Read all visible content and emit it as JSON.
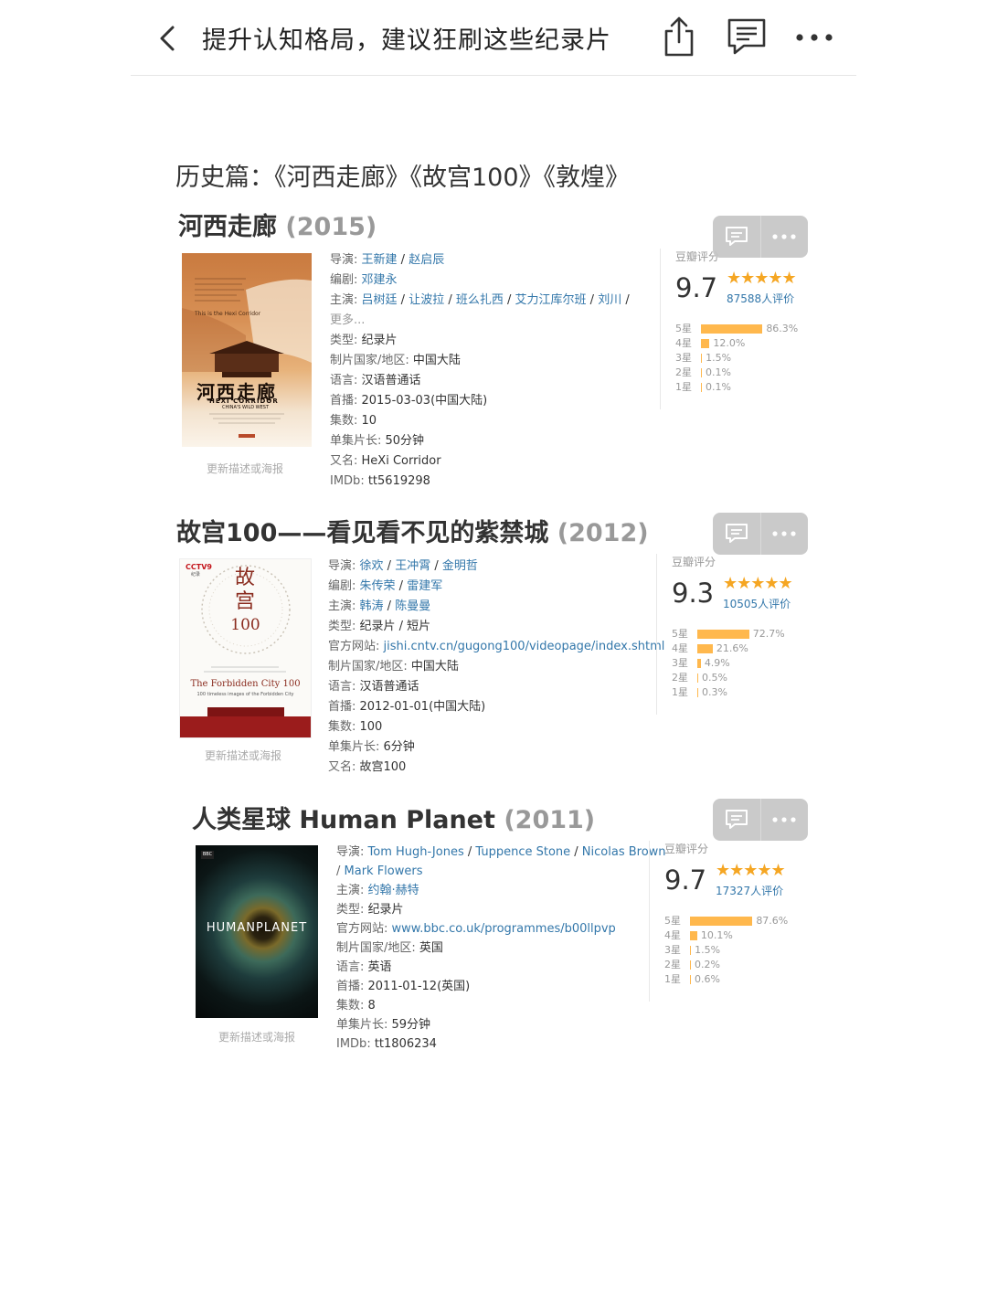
{
  "nav": {
    "title": "提升认知格局，建议狂刷这些纪录片",
    "back_icon": "chevron-left-icon",
    "share_icon": "share-icon",
    "comment_icon": "comment-icon",
    "more_icon": "more-icon"
  },
  "section_heading": "历史篇：《河西走廊》《故宫100》《敦煌》",
  "common": {
    "rating_label": "豆瓣评分",
    "update_link": "更新描述或海报"
  },
  "films": [
    {
      "title": "河西走廊",
      "year": "(2015)",
      "poster": {
        "title_cn": "河西走廊",
        "sub": "HEXI CORRIDOR",
        "sub2": "CHINA'S WILD WEST",
        "text": "This is the Hexi Corridor"
      },
      "info": [
        {
          "label": "导演: ",
          "links": [
            "王新建",
            "赵启辰"
          ]
        },
        {
          "label": "编剧: ",
          "links": [
            "邓建永"
          ]
        },
        {
          "label": "主演: ",
          "links": [
            "吕树廷",
            "让波拉",
            "班么扎西",
            "艾力江库尔班",
            "刘川"
          ],
          "trail": " /"
        },
        {
          "label": "更多...",
          "muted": true
        },
        {
          "label": "类型: ",
          "value": "纪录片"
        },
        {
          "label": "制片国家/地区: ",
          "value": "中国大陆"
        },
        {
          "label": "语言: ",
          "value": "汉语普通话"
        },
        {
          "label": "首播: ",
          "value": "2015-03-03(中国大陆)"
        },
        {
          "label": "集数: ",
          "value": "10"
        },
        {
          "label": "单集片长: ",
          "value": "50分钟"
        },
        {
          "label": "又名: ",
          "value": "HeXi Corridor"
        },
        {
          "label": "IMDb: ",
          "value": "tt5619298"
        }
      ],
      "rating": {
        "score": "9.7",
        "stars": "★★★★★",
        "votes": "87588人评价",
        "dist": [
          {
            "label": "5星",
            "pct": "86.3%",
            "v": 86.3
          },
          {
            "label": "4星",
            "pct": "12.0%",
            "v": 12.0
          },
          {
            "label": "3星",
            "pct": "1.5%",
            "v": 1.5
          },
          {
            "label": "2星",
            "pct": "0.1%",
            "v": 0.1
          },
          {
            "label": "1星",
            "pct": "0.1%",
            "v": 0.1
          }
        ]
      }
    },
    {
      "title": "故宫100——看见看不见的紫禁城",
      "year": "(2012)",
      "poster": {
        "title_cn": "故宫",
        "num": "100",
        "en": "The Forbidden City 100",
        "en2": "100 timeless images of the Forbidden City",
        "brand": "CCTV9",
        "brand_sub": "纪录"
      },
      "info": [
        {
          "label": "导演: ",
          "links": [
            "徐欢",
            "王冲霄",
            "金明哲"
          ]
        },
        {
          "label": "编剧: ",
          "links": [
            "朱传荣",
            "雷建军"
          ]
        },
        {
          "label": "主演: ",
          "links": [
            "韩涛",
            "陈曼曼"
          ]
        },
        {
          "label": "类型: ",
          "value": "纪录片 / 短片"
        },
        {
          "label": "官方网站: ",
          "links": [
            "jishi.cntv.cn/gugong100/videopage/index.shtml"
          ]
        },
        {
          "label": "制片国家/地区: ",
          "value": "中国大陆"
        },
        {
          "label": "语言: ",
          "value": "汉语普通话"
        },
        {
          "label": "首播: ",
          "value": "2012-01-01(中国大陆)"
        },
        {
          "label": "集数: ",
          "value": "100"
        },
        {
          "label": "单集片长: ",
          "value": "6分钟"
        },
        {
          "label": "又名: ",
          "value": "故宫100"
        }
      ],
      "rating": {
        "score": "9.3",
        "stars": "★★★★★",
        "votes": "10505人评价",
        "dist": [
          {
            "label": "5星",
            "pct": "72.7%",
            "v": 72.7
          },
          {
            "label": "4星",
            "pct": "21.6%",
            "v": 21.6
          },
          {
            "label": "3星",
            "pct": "4.9%",
            "v": 4.9
          },
          {
            "label": "2星",
            "pct": "0.5%",
            "v": 0.5
          },
          {
            "label": "1星",
            "pct": "0.3%",
            "v": 0.3
          }
        ]
      }
    },
    {
      "title": "人类星球 Human Planet",
      "year": "(2011)",
      "poster": {
        "title_cn": "HUMANPLANET",
        "brand": "BBC"
      },
      "info": [
        {
          "label": "导演: ",
          "links": [
            "Tom Hugh-Jones",
            "Tuppence Stone",
            "Nicolas Brown"
          ]
        },
        {
          "label": "/ ",
          "links": [
            "Mark Flowers"
          ],
          "cont": true
        },
        {
          "label": "主演: ",
          "links": [
            "约翰·赫特"
          ]
        },
        {
          "label": "类型: ",
          "value": "纪录片"
        },
        {
          "label": "官方网站: ",
          "links": [
            "www.bbc.co.uk/programmes/b00llpvp"
          ]
        },
        {
          "label": "制片国家/地区: ",
          "value": "英国"
        },
        {
          "label": "语言: ",
          "value": "英语"
        },
        {
          "label": "首播: ",
          "value": "2011-01-12(英国)"
        },
        {
          "label": "集数: ",
          "value": "8"
        },
        {
          "label": "单集片长: ",
          "value": "59分钟"
        },
        {
          "label": "IMDb: ",
          "value": "tt1806234"
        }
      ],
      "rating": {
        "score": "9.7",
        "stars": "★★★★★",
        "votes": "17327人评价",
        "dist": [
          {
            "label": "5星",
            "pct": "87.6%",
            "v": 87.6
          },
          {
            "label": "4星",
            "pct": "10.1%",
            "v": 10.1
          },
          {
            "label": "3星",
            "pct": "1.5%",
            "v": 1.5
          },
          {
            "label": "2星",
            "pct": "0.2%",
            "v": 0.2
          },
          {
            "label": "1星",
            "pct": "0.6%",
            "v": 0.6
          }
        ]
      }
    }
  ],
  "colors": {
    "link": "#3377aa",
    "star": "#f5a623",
    "bar": "#ffb84d"
  }
}
